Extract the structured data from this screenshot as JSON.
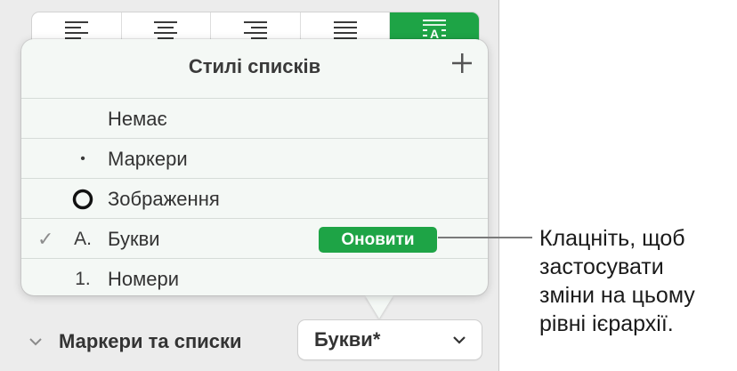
{
  "align_bar": {
    "buttons": [
      {
        "icon": "align-left-icon",
        "active": false
      },
      {
        "icon": "align-center-icon",
        "active": false
      },
      {
        "icon": "align-right-icon",
        "active": false
      },
      {
        "icon": "align-justify-icon",
        "active": false
      },
      {
        "icon": "text-direction-icon",
        "active": true
      }
    ]
  },
  "popover": {
    "title": "Стилі списків",
    "add_icon": "plus-icon",
    "items": [
      {
        "mark": "",
        "label": "Немає",
        "checked": false
      },
      {
        "mark": "•",
        "label": "Маркери",
        "checked": false
      },
      {
        "mark": "circle-image-icon",
        "label": "Зображення",
        "checked": false
      },
      {
        "mark": "A.",
        "label": "Букви",
        "checked": true
      },
      {
        "mark": "1.",
        "label": "Номери",
        "checked": false
      }
    ],
    "check_mark": "✓",
    "update_button": "Оновити"
  },
  "section": {
    "label": "Маркери та списки",
    "dropdown_value": "Букви*"
  },
  "callout": {
    "lines": [
      "Клацніть, щоб",
      "застосувати",
      "зміни на цьому",
      "рівні ієрархії."
    ]
  },
  "colors": {
    "accent": "#1ea446",
    "panel": "#ececec",
    "popover": "#f4f8f5"
  }
}
